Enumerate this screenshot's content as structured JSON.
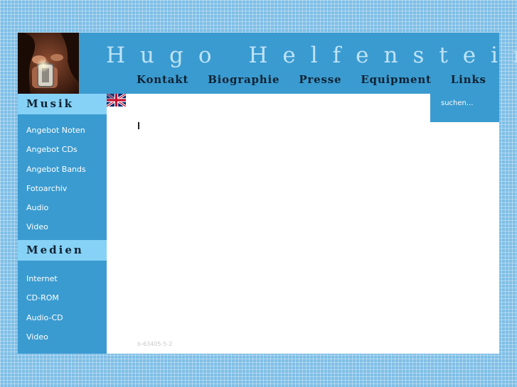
{
  "header": {
    "title": "Hugo Helfenstein",
    "nav": [
      "Kontakt",
      "Biographie",
      "Presse",
      "Equipment",
      "Links"
    ]
  },
  "sidebar": {
    "sections": [
      {
        "heading": "Musik",
        "items": [
          "Angebot Noten",
          "Angebot CDs",
          "Angebot Bands",
          "Fotoarchiv",
          "Audio",
          "Video"
        ]
      },
      {
        "heading": "Medien",
        "items": [
          "Internet",
          "CD-ROM",
          "Audio-CD",
          "Video"
        ]
      }
    ]
  },
  "search": {
    "label": "suchen..."
  },
  "footer": {
    "code": "b-63405-5-2"
  },
  "icons": {
    "language": "uk-flag-icon",
    "photo": "portrait-photo"
  },
  "colors": {
    "frame": "#3a9bd0",
    "section_head": "#86d2f6",
    "background": "#7fbfe6"
  }
}
